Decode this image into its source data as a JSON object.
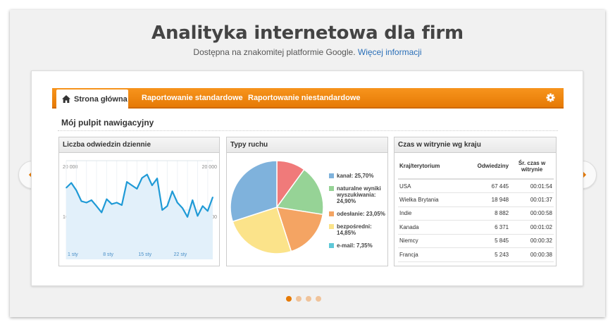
{
  "header": {
    "title": "Analityka internetowa dla firm",
    "subtitle": "Dostępna na znakomitej platformie Google.",
    "more_link": "Więcej informacji"
  },
  "nav": {
    "home": "Strona główna",
    "standard": "Raportowanie standardowe",
    "custom": "Raportowanie niestandardowe"
  },
  "dashboard_title": "Mój pulpit nawigacyjny",
  "panels": {
    "visits": {
      "title": "Liczba odwiedzin dziennie",
      "y_top_left": "20 000",
      "y_top_right": "20 000",
      "y_mid_left": "10 000",
      "y_mid_right": "10 000",
      "dates": [
        "1 sty",
        "8 sty",
        "15 sty",
        "22 sty"
      ]
    },
    "traffic": {
      "title": "Typy ruchu",
      "legend": [
        {
          "label": "kanał: 25,70%",
          "color": "#e86c6c"
        },
        {
          "label": "naturalne wyniki wyszukiwania: 24,90%",
          "color": "#6fbf6f"
        },
        {
          "label": "odesłanie: 23,05%",
          "color": "#f0964a"
        },
        {
          "label": "bezpośredni: 14,85%",
          "color": "#f3dc5a"
        },
        {
          "label": "e-mail: 7,35%",
          "color": "#5ec8d8"
        }
      ]
    },
    "countries": {
      "title": "Czas w witrynie wg kraju",
      "col_country": "Kraj/terytorium",
      "col_visits": "Odwiedziny",
      "col_time": "Śr. czas w witrynie",
      "rows": [
        {
          "country": "USA",
          "visits": "67 445",
          "time": "00:01:54"
        },
        {
          "country": "Wielka Brytania",
          "visits": "18 948",
          "time": "00:01:37"
        },
        {
          "country": "Indie",
          "visits": "8 882",
          "time": "00:00:58"
        },
        {
          "country": "Kanada",
          "visits": "6 371",
          "time": "00:01:02"
        },
        {
          "country": "Niemcy",
          "visits": "5 845",
          "time": "00:00:32"
        },
        {
          "country": "Francja",
          "visits": "5 243",
          "time": "00:00:38"
        }
      ]
    }
  },
  "chart_data": [
    {
      "type": "line",
      "title": "Liczba odwiedzin dziennie",
      "x": [
        1,
        2,
        3,
        4,
        5,
        6,
        7,
        8,
        9,
        10,
        11,
        12,
        13,
        14,
        15,
        16,
        17,
        18,
        19,
        20,
        21,
        22,
        23,
        24,
        25,
        26,
        27,
        28,
        29,
        30
      ],
      "x_tick_labels": [
        "1 sty",
        "8 sty",
        "15 sty",
        "22 sty"
      ],
      "series": [
        {
          "values": [
            14500,
            15500,
            14000,
            11800,
            11500,
            12000,
            10800,
            9500,
            12200,
            11200,
            11500,
            11000,
            15700,
            15000,
            14300,
            16500,
            17200,
            15000,
            16400,
            10000,
            10800,
            13800,
            11500,
            10400,
            8600,
            12000,
            8800,
            10800,
            9800,
            12600
          ]
        }
      ],
      "ylim": [
        0,
        20000
      ],
      "y_ticks": [
        10000,
        20000
      ],
      "color": "#1f9ad6"
    },
    {
      "type": "pie",
      "title": "Typy ruchu",
      "labels": [
        "kanał",
        "naturalne wyniki wyszukiwania",
        "odesłanie",
        "bezpośredni",
        "e-mail"
      ],
      "values": [
        25.7,
        24.9,
        23.05,
        14.85,
        7.35
      ],
      "displayed_slices": [
        {
          "value": 10.0,
          "color": "#f07a7a"
        },
        {
          "value": 17.5,
          "color": "#96d396"
        },
        {
          "value": 17.5,
          "color": "#f4a463"
        },
        {
          "value": 25.0,
          "color": "#fbe38a"
        },
        {
          "value": 30.0,
          "color": "#7fb2dc"
        }
      ]
    }
  ],
  "colors": {
    "accent": "#f7941d",
    "link": "#2a6fb8"
  }
}
